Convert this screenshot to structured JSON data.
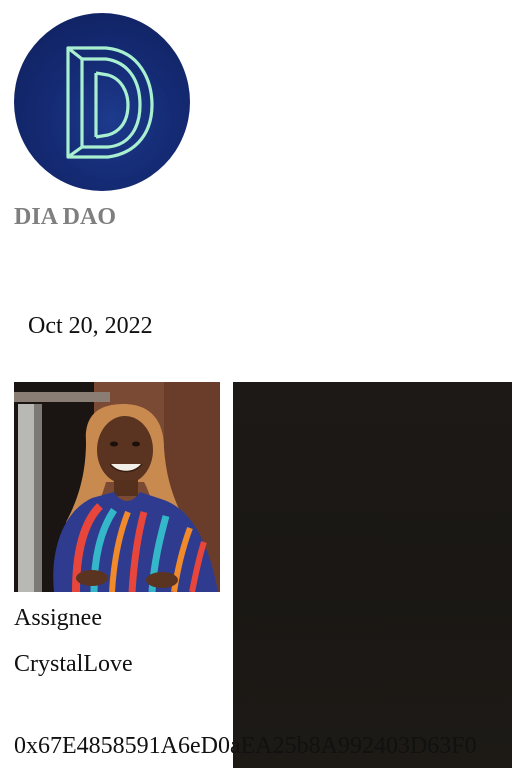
{
  "organization": {
    "name": "DIA DAO",
    "logo_icon": "dia-dao-d-logo-icon",
    "logo_colors": {
      "background": "#142a73",
      "mark": "#a8f0d0"
    }
  },
  "post": {
    "date": "Oct 20, 2022"
  },
  "assignee": {
    "role_label": "Assignee",
    "username": "CrystalLove",
    "avatar_icon": "user-avatar-photo",
    "wallet_address": "0x67E4858591A6eD0aEA25b8A992403D63F0"
  },
  "media_panel": {
    "background_color": "#1b1815"
  }
}
